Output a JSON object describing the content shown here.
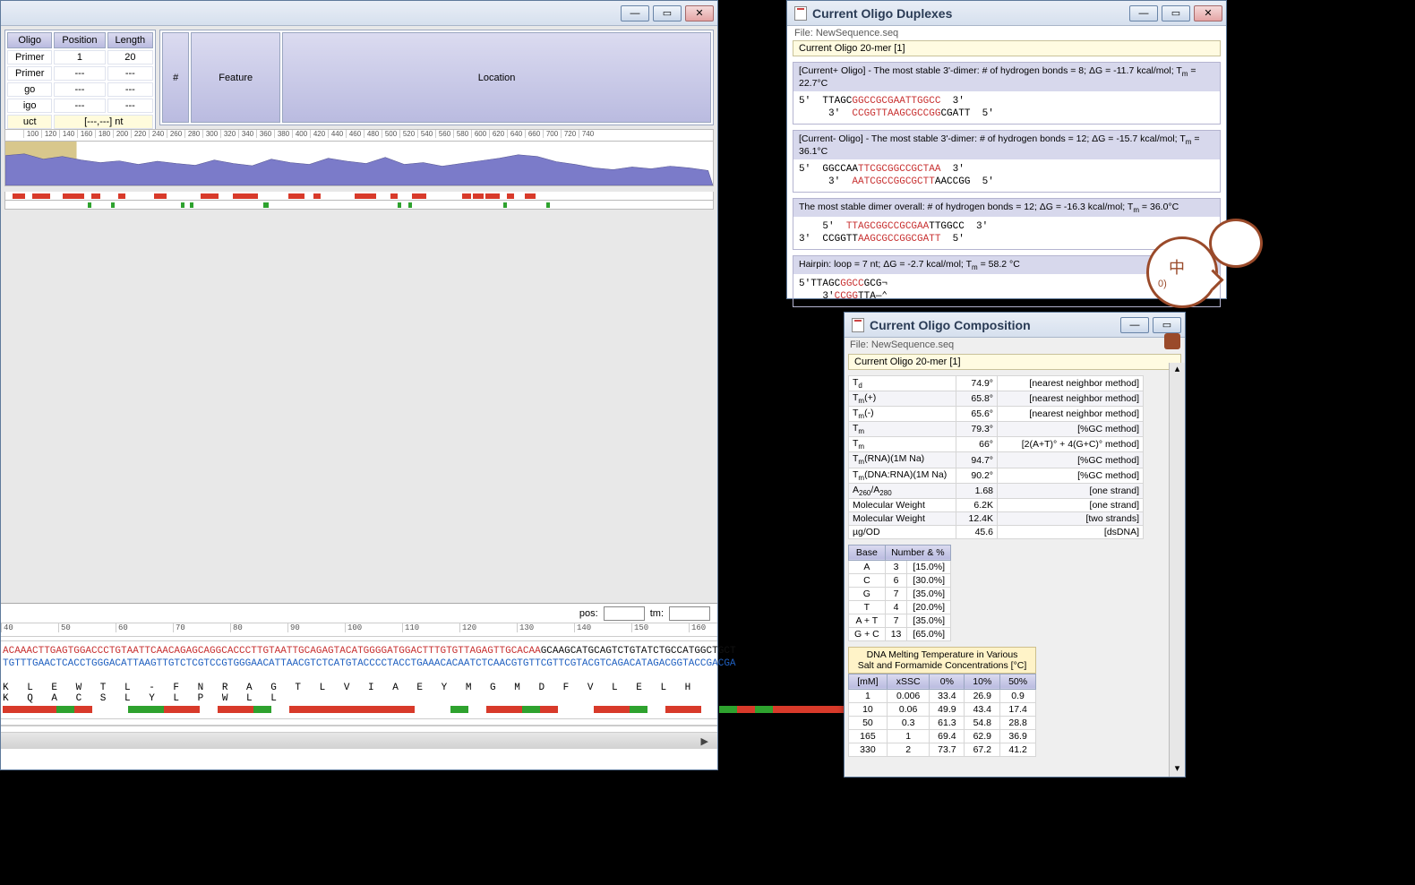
{
  "left": {
    "oligo_table": {
      "headers": [
        "Oligo",
        "Position",
        "Length"
      ],
      "rows": [
        {
          "o": "Primer",
          "p": "1",
          "l": "20"
        },
        {
          "o": "Primer",
          "p": "---",
          "l": "---"
        },
        {
          "o": "go",
          "p": "---",
          "l": "---"
        },
        {
          "o": "igo",
          "p": "---",
          "l": "---"
        },
        {
          "o": "uct",
          "p": "[---,---] nt",
          "l": "",
          "span": true
        }
      ]
    },
    "feature_table": {
      "headers": [
        "#",
        "Feature",
        "Location"
      ]
    },
    "ruler_ticks": [
      "",
      "100",
      "120",
      "140",
      "160",
      "180",
      "200",
      "220",
      "240",
      "260",
      "280",
      "300",
      "320",
      "340",
      "360",
      "380",
      "400",
      "420",
      "440",
      "460",
      "480",
      "500",
      "520",
      "540",
      "560",
      "580",
      "600",
      "620",
      "640",
      "660",
      "700",
      "720",
      "740"
    ],
    "pos_label": "pos:",
    "tm_label": "tm:",
    "seq_ruler": [
      "40",
      "50",
      "60",
      "70",
      "80",
      "90",
      "100",
      "110",
      "120",
      "130",
      "140",
      "150",
      "160"
    ],
    "seq_top_red": "ACAAACTTGAGTGGACCCTGTAATTCAACAGAGCAGGCACCCTTGTAATTGCAGAGTACATGGGGATGGACTTTGTGTTAGAGTTGCACAA",
    "seq_top_blk": "GCAAGCATGCAGTCTGTATCTGCCATGGCTGCT",
    "seq_bot": "TGTTTGAACTCACCTGGGACATTAAGTTGTCTCGTCCGTGGGAACATTAACGTCTCATGTACCCCTACCTGAAACACAATCTCAACGTGTTCGTTCGTACGTCAGACATAGACGGTACCGACGA",
    "aa": "K  L  E  W  T  L  -  F  N  R  A  G  T  L  V  I  A  E  Y  M  G  M  D  F  V  L  E  L  H  K  Q  A  C  S  L  Y  L  P  W  L  L"
  },
  "dup": {
    "title": "Current Oligo Duplexes",
    "file": "File: NewSequence.seq",
    "sub": "Current Oligo 20-mer [1]",
    "groups": [
      {
        "head": "[Current+ Oligo] - The most stable 3'-dimer: # of hydrogen bonds = 8; ΔG = -11.7 kcal/mol; T<sub>m</sub> = 22.7°C",
        "lines": [
          "5'  TTAGC<r>GGCCGCGAATTGGCC</r>  3'",
          "     3'  <r>CCGGTTAAGCGCCGG</r>CGATT  5'"
        ]
      },
      {
        "head": "[Current- Oligo] - The most stable 3'-dimer: # of hydrogen bonds = 12; ΔG = -15.7 kcal/mol; T<sub>m</sub> = 36.1°C",
        "lines": [
          "5'  GGCCAA<r>TTCGCGGCCGCTAA</r>  3'",
          "     3'  <r>AATCGCCGGCGCTT</r>AACCGG  5'"
        ]
      },
      {
        "head": "The most stable dimer overall: # of hydrogen bonds = 12; ΔG = -16.3 kcal/mol; T<sub>m</sub> = 36.0°C",
        "lines": [
          "    5'  <r>TTAGCGGCCGCGAA</r>TTGGCC  3'",
          "3'  CCGGTT<r>AAGCGCCGGCGATT</r>  5'"
        ]
      },
      {
        "head": "Hairpin: loop = 7 nt;  ΔG = -2.7 kcal/mol; T<sub>m</sub> = 58.2 °C",
        "lines": [
          "5'TTAGC<r>GGCC</r>GCG¬",
          "    3'<r>CCGG</r>TTA—⌃"
        ]
      }
    ]
  },
  "comp": {
    "title": "Current Oligo Composition",
    "file": "File: NewSequence.seq",
    "sub": "Current Oligo 20-mer [1]",
    "props": [
      {
        "k": "T<sub>d</sub>",
        "v": "74.9°",
        "m": "[nearest neighbor method]"
      },
      {
        "k": "T<sub>m</sub>(+)",
        "v": "65.8°",
        "m": "[nearest neighbor method]"
      },
      {
        "k": "T<sub>m</sub>(-)",
        "v": "65.6°",
        "m": "[nearest neighbor method]"
      },
      {
        "k": "T<sub>m</sub>",
        "v": "79.3°",
        "m": "[%GC method]"
      },
      {
        "k": "T<sub>m</sub>",
        "v": "66°",
        "m": "[2(A+T)° + 4(G+C)° method]"
      },
      {
        "k": "T<sub>m</sub>(RNA)(1M Na)",
        "v": "94.7°",
        "m": "[%GC method]"
      },
      {
        "k": "T<sub>m</sub>(DNA:RNA)(1M Na)",
        "v": "90.2°",
        "m": "[%GC method]"
      },
      {
        "k": "A<sub>260</sub>/A<sub>280</sub>",
        "v": "1.68",
        "m": "[one strand]"
      },
      {
        "k": "Molecular Weight",
        "v": "6.2K",
        "m": "[one strand]"
      },
      {
        "k": "Molecular Weight",
        "v": "12.4K",
        "m": "[two strands]"
      },
      {
        "k": "µg/OD",
        "v": "45.6",
        "m": "[dsDNA]"
      }
    ],
    "base_headers": [
      "Base",
      "Number & %"
    ],
    "bases": [
      {
        "b": "A",
        "n": "3",
        "p": "[15.0%]"
      },
      {
        "b": "C",
        "n": "6",
        "p": "[30.0%]"
      },
      {
        "b": "G",
        "n": "7",
        "p": "[35.0%]"
      },
      {
        "b": "T",
        "n": "4",
        "p": "[20.0%]"
      },
      {
        "b": "A + T",
        "n": "7",
        "p": "[35.0%]"
      },
      {
        "b": "G + C",
        "n": "13",
        "p": "[65.0%]"
      }
    ],
    "salt_head1": "DNA Melting Temperature in Various",
    "salt_head2": "Salt and Formamide Concentrations [°C]",
    "salt_headers": [
      "[mM]",
      "xSSC",
      "0%",
      "10%",
      "50%"
    ],
    "salt_rows": [
      {
        "m": "1",
        "x": "0.006",
        "a": "33.4",
        "b": "26.9",
        "c": "0.9"
      },
      {
        "m": "10",
        "x": "0.06",
        "a": "49.9",
        "b": "43.4",
        "c": "17.4"
      },
      {
        "m": "50",
        "x": "0.3",
        "a": "61.3",
        "b": "54.8",
        "c": "28.8"
      },
      {
        "m": "165",
        "x": "1",
        "a": "69.4",
        "b": "62.9",
        "c": "36.9"
      },
      {
        "m": "330",
        "x": "2",
        "a": "73.7",
        "b": "67.2",
        "c": "41.2"
      }
    ]
  },
  "cartoon": {
    "cn": "中",
    "s": "0)"
  },
  "chart_data": {
    "type": "area",
    "title": "",
    "xlim": [
      0,
      745
    ],
    "ylim": [
      0,
      100
    ],
    "note": "Approximate profile (e.g. %GC / free-energy plot) across sequence positions; values below are visual estimates of the curve height in percent of track height at ~20-nt intervals.",
    "highlight_range": [
      0,
      75
    ],
    "x": [
      0,
      20,
      40,
      60,
      80,
      100,
      120,
      140,
      160,
      180,
      200,
      220,
      240,
      260,
      280,
      300,
      320,
      340,
      360,
      380,
      400,
      420,
      440,
      460,
      480,
      500,
      520,
      540,
      560,
      580,
      600,
      620,
      640,
      660,
      680,
      700,
      720,
      740
    ],
    "y": [
      68,
      72,
      60,
      66,
      58,
      52,
      56,
      48,
      55,
      50,
      46,
      58,
      50,
      45,
      60,
      52,
      48,
      62,
      55,
      50,
      64,
      48,
      52,
      44,
      50,
      56,
      62,
      70,
      66,
      54,
      48,
      40,
      36,
      42,
      38,
      44,
      40,
      34
    ]
  }
}
